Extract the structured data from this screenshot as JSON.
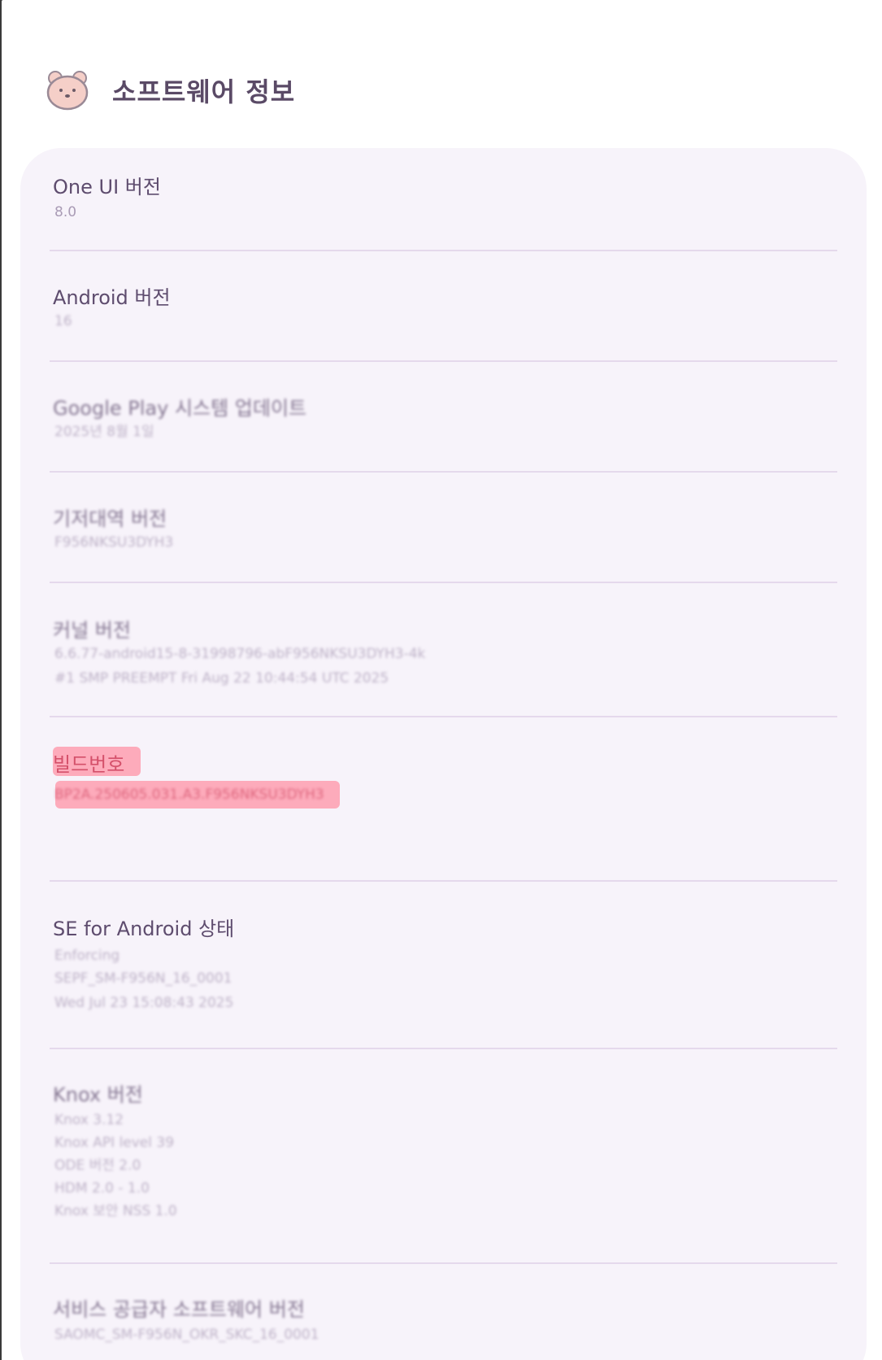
{
  "header": {
    "title": "소프트웨어 정보",
    "icon": "bear-icon"
  },
  "items": [
    {
      "title": "One UI 버전",
      "values": [
        "8.0"
      ],
      "blurred": false
    },
    {
      "title": "Android 버전",
      "values": [
        "16"
      ],
      "blurred": false
    },
    {
      "title": "Google Play 시스템 업데이트",
      "values": [
        "2025년 8월 1일"
      ],
      "blurred": true
    },
    {
      "title": "기저대역 버전",
      "values": [
        "F956NKSU3DYH3"
      ],
      "blurred": true
    },
    {
      "title": "커널 버전",
      "values": [
        "6.6.77-android15-8-31998796-abF956NKSU3DYH3-4k",
        "#1 SMP PREEMPT Fri Aug 22 10:44:54 UTC 2025"
      ],
      "blurred": true
    },
    {
      "title": "빌드번호",
      "values": [
        "BP2A.250605.031.A3.F956NKSU3DYH3"
      ],
      "blurred": true,
      "highlighted": true
    },
    {
      "title": "SE for Android 상태",
      "values": [
        "Enforcing",
        "SEPF_SM-F956N_16_0001",
        "Wed Jul 23 15:08:43 2025"
      ],
      "blurred": true
    },
    {
      "title": "Knox 버전",
      "values": [
        "Knox 3.12",
        "Knox API level 39",
        "ODE 버전 2.0",
        "HDM 2.0 - 1.0",
        "Knox 보안 NSS 1.0"
      ],
      "blurred": true
    },
    {
      "title": "서비스 공급자 소프트웨어 버전",
      "values": [
        "SAOMC_SM-F956N_OKR_SKC_16_0001"
      ],
      "blurred": true
    }
  ],
  "colors": {
    "card": "#f7f3fa",
    "title": "#5e4c6e",
    "value": "#a99bb5",
    "highlight": "#ff8ca0"
  }
}
